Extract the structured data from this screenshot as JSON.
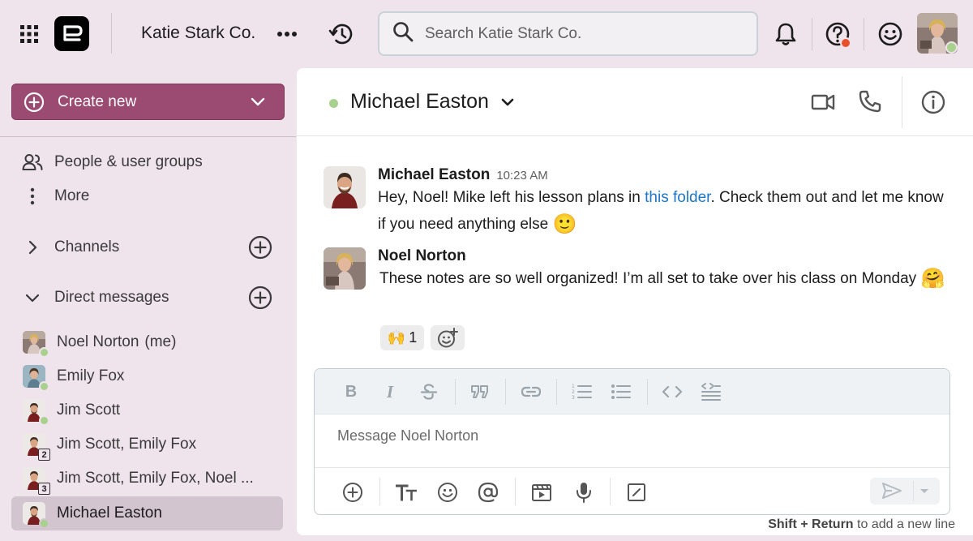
{
  "header": {
    "workspace_name": "Katie Stark Co.",
    "search_placeholder": "Search Katie Stark Co."
  },
  "sidebar": {
    "create_label": "Create new",
    "people_label": "People & user groups",
    "more_label": "More",
    "channels_label": "Channels",
    "dm_label": "Direct messages",
    "dms": [
      {
        "name": "Noel Norton",
        "suffix": "(me)"
      },
      {
        "name": "Emily Fox"
      },
      {
        "name": "Jim Scott"
      },
      {
        "name": "Jim Scott, Emily Fox",
        "count": "2"
      },
      {
        "name": "Jim Scott, Emily Fox, Noel ...",
        "count": "3"
      },
      {
        "name": "Michael Easton"
      }
    ]
  },
  "chat": {
    "title": "Michael Easton",
    "messages": [
      {
        "author": "Michael Easton",
        "time": "10:23 AM",
        "text_before": "Hey, Noel! Mike left his lesson plans in ",
        "link": "this folder",
        "text_after": ". Check them out and let me know if you need anything else",
        "emoji": "🙂"
      },
      {
        "author": "Noel Norton",
        "text": "These notes are so well organized! I’m all set to take over his class on Monday",
        "emoji": "🤗",
        "reaction_emoji": "🙌",
        "reaction_count": "1"
      }
    ],
    "composer_placeholder": "Message Noel Norton",
    "hint_bold": "Shift + Return",
    "hint_text": " to add a new line"
  },
  "colors": {
    "accent": "#9b4a72",
    "presence": "#a9d18e",
    "link": "#1d76c7",
    "notification": "#e8502c"
  }
}
